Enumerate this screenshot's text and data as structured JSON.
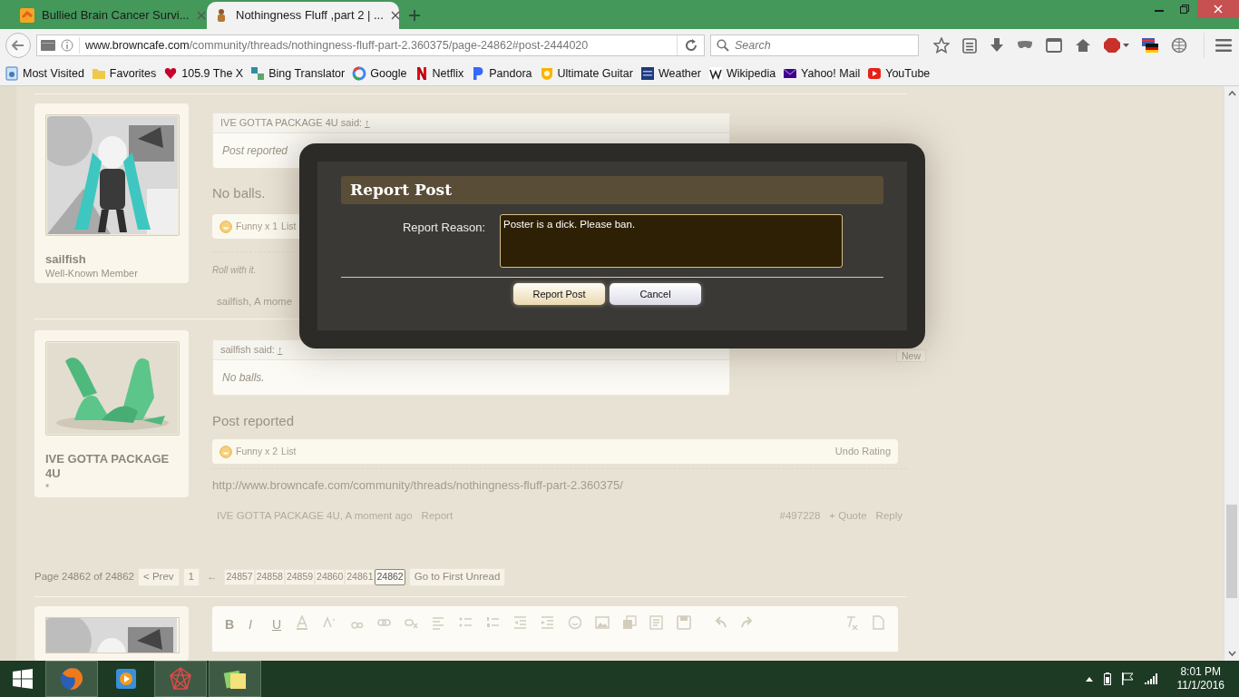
{
  "browser": {
    "tabs": [
      {
        "title": "Bullied Brain Cancer Survi...",
        "selected": false
      },
      {
        "title": "Nothingness Fluff ,part 2 | ...",
        "selected": true
      }
    ],
    "url": {
      "host": "www.browncafe.com",
      "path": "/community/threads/nothingness-fluff-part-2.360375/page-24862#post-2444020"
    },
    "search": {
      "placeholder": "Search"
    },
    "bookmarks": [
      "Most Visited",
      "Favorites",
      "105.9 The X",
      "Bing Translator",
      "Google",
      "Netflix",
      "Pandora",
      "Ultimate Guitar",
      "Weather",
      "Wikipedia",
      "Yahoo! Mail",
      "YouTube"
    ]
  },
  "posts": [
    {
      "author": "sailfish",
      "role": "Well-Known Member",
      "quote": {
        "attribution": "IVE GOTTA PACKAGE 4U said:",
        "arrow": "↑",
        "text": "Post reported"
      },
      "message": "No balls.",
      "rating": {
        "label": "Funny x 1",
        "list": "List"
      },
      "signature": "Roll with it.",
      "byline": "sailfish, A mome"
    },
    {
      "author": "IVE GOTTA PACKAGE 4U",
      "role": "*",
      "badge": "New",
      "quote": {
        "attribution": "sailfish said:",
        "arrow": "↑",
        "text": "No balls."
      },
      "message": "Post reported",
      "rating": {
        "label": "Funny x 2",
        "list": "List",
        "undo": "Undo Rating"
      },
      "link": "http://www.browncafe.com/community/threads/nothingness-fluff-part-2.360375/",
      "byline": "IVE GOTTA PACKAGE 4U, A moment ago",
      "report": "Report",
      "number": "#497228",
      "quote_link": "+ Quote",
      "reply": "Reply"
    }
  ],
  "pagination": {
    "summary": "Page 24862 of 24862",
    "prev": "< Prev",
    "first": "1",
    "skip": "←",
    "pages": [
      {
        "label": "24857",
        "selected": false
      },
      {
        "label": "24858",
        "selected": false
      },
      {
        "label": "24859",
        "selected": false
      },
      {
        "label": "24860",
        "selected": false
      },
      {
        "label": "24861",
        "selected": false
      },
      {
        "label": "24862",
        "selected": true
      }
    ],
    "unread": "Go to First Unread"
  },
  "editor": {
    "format_buttons": [
      "B",
      "I",
      "U"
    ]
  },
  "dialog": {
    "title": "Report Post",
    "label": "Report Reason:",
    "value": "Poster is a dick. Please ban.",
    "buttons": [
      "Report Post",
      "Cancel"
    ]
  },
  "taskbar": {
    "time": "8:01 PM",
    "date": "11/1/2016"
  }
}
